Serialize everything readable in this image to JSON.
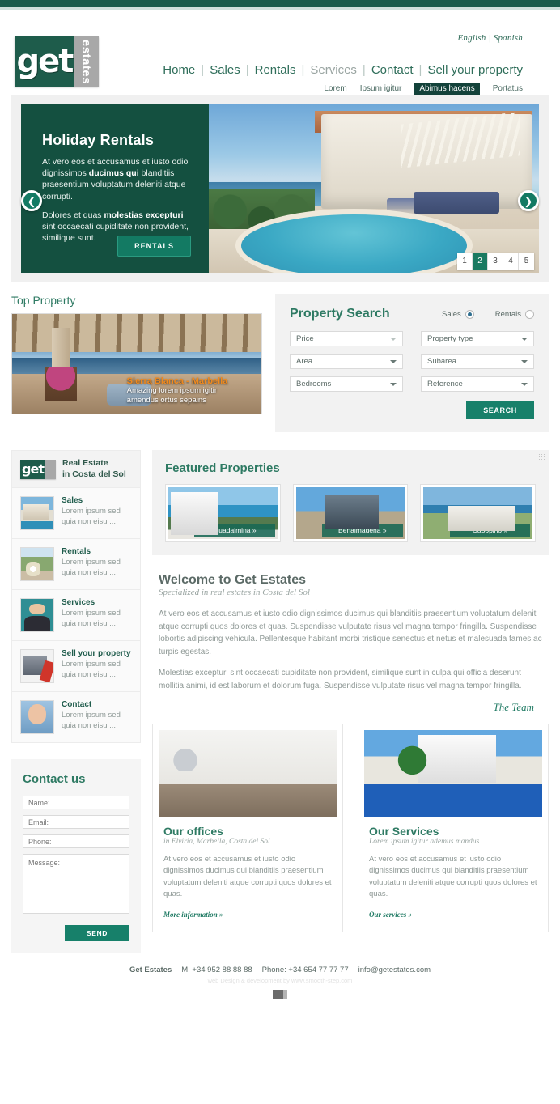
{
  "topbar": {
    "color": "#1a5c4a"
  },
  "header": {
    "lang": {
      "english": "English",
      "separator": "|",
      "spanish": "Spanish"
    },
    "logo": {
      "get": "get",
      "estates": "estates"
    },
    "mainnav": [
      {
        "label": "Home",
        "dim": false
      },
      {
        "label": "Sales",
        "dim": false
      },
      {
        "label": "Rentals",
        "dim": false
      },
      {
        "label": "Services",
        "dim": true
      },
      {
        "label": "Contact",
        "dim": false
      },
      {
        "label": "Sell your property",
        "dim": false
      }
    ],
    "subnav": [
      {
        "label": "Lorem",
        "active": false
      },
      {
        "label": "Ipsum igitur",
        "active": false
      },
      {
        "label": "Abimus hacens",
        "active": true
      },
      {
        "label": "Portatus",
        "active": false
      }
    ]
  },
  "hero": {
    "title": "Holiday Rentals",
    "para1_a": "At vero eos et accusamus et iusto odio dignissimos ",
    "para1_b": "ducimus qui",
    "para1_c": " blanditiis praesentium voluptatum deleniti atque corrupti.",
    "para2_a": "Dolores et quas ",
    "para2_b": "molestias excepturi",
    "para2_c": " sint occaecati cupiditate non provident, similique sunt.",
    "button": "RENTALS",
    "prev_icon": "chevron-left-icon",
    "next_icon": "chevron-right-icon",
    "pages": [
      "1",
      "2",
      "3",
      "4",
      "5"
    ],
    "active_page": "2"
  },
  "top_property": {
    "title": "Top Property",
    "caption_title": "Sierra Blanca - Marbella",
    "caption_text": "Amazing lorem ipsum igitir amendus ortus sepains"
  },
  "search": {
    "title": "Property Search",
    "radios": [
      {
        "label": "Sales",
        "selected": true
      },
      {
        "label": "Rentals",
        "selected": false
      }
    ],
    "fields": [
      {
        "label": "Price",
        "caret": "light"
      },
      {
        "label": "Property type",
        "caret": "dark"
      },
      {
        "label": "Area",
        "caret": "dark"
      },
      {
        "label": "Subarea",
        "caret": "dark"
      },
      {
        "label": "Bedrooms",
        "caret": "dark"
      },
      {
        "label": "Reference",
        "caret": "dark"
      }
    ],
    "button": "SEARCH"
  },
  "sidebar": {
    "head_line1": "Real Estate",
    "head_line2": "in Costa del Sol",
    "items": [
      {
        "label": "Sales",
        "desc": "Lorem ipsum sed quia non eisu ...",
        "thumb": "t-sales"
      },
      {
        "label": "Rentals",
        "desc": "Lorem ipsum sed quia non eisu ...",
        "thumb": "t-rentals"
      },
      {
        "label": "Services",
        "desc": "Lorem ipsum sed quia non eisu ...",
        "thumb": "t-services"
      },
      {
        "label": "Sell your property",
        "desc": "Lorem ipsum sed quia non eisu ...",
        "thumb": "t-sell"
      },
      {
        "label": "Contact",
        "desc": "Lorem ipsum sed quia non eisu ...",
        "thumb": "t-contact"
      }
    ]
  },
  "contact_form": {
    "title": "Contact us",
    "name_placeholder": "Name:",
    "email_placeholder": "Email:",
    "phone_placeholder": "Phone:",
    "message_placeholder": "Message:",
    "send_label": "SEND"
  },
  "featured": {
    "title": "Featured Properties",
    "items": [
      {
        "label": "Guadalmina »",
        "img": "f1"
      },
      {
        "label": "Benalmádena »",
        "img": "f2"
      },
      {
        "label": "Cabopino »",
        "img": "f3"
      }
    ]
  },
  "welcome": {
    "title": "Welcome to Get Estates",
    "subtitle": "Specialized in real estates in Costa del Sol",
    "para1": "At vero eos et accusamus et iusto odio dignissimos ducimus qui blanditiis praesentium voluptatum deleniti atque corrupti quos dolores et quas. Suspendisse vulputate risus vel magna tempor fringilla. Suspendisse lobortis adipiscing vehicula. Pellentesque habitant morbi tristique senectus et netus et malesuada fames ac turpis egestas.",
    "para2": "Molestias excepturi sint occaecati cupiditate non provident, similique sunt in culpa qui officia deserunt mollitia animi, id est laborum et dolorum fuga. Suspendisse vulputate risus vel magna tempor fringilla.",
    "signature": "The Team"
  },
  "cards": [
    {
      "title": "Our offices",
      "subtitle": "in Elviria, Marbella, Costa del Sol",
      "text": "At vero eos et accusamus et iusto odio dignissimos ducimus qui blanditiis praesentium voluptatum deleniti atque corrupti quos dolores et quas.",
      "link": "More information »",
      "img": "c1"
    },
    {
      "title": "Our Services",
      "subtitle": "Lorem ipsum igitur ademus mandus",
      "text": "At vero eos et accusamus et iusto odio dignissimos ducimus qui blanditiis praesentium voluptatum deleniti atque corrupti quos dolores et quas.",
      "link": "Our services »",
      "img": "c2"
    }
  ],
  "footer": {
    "company": "Get Estates",
    "mobile": "M. +34 952 88 88 88",
    "phone": "Phone: +34 654 77 77 77",
    "email": "info@getestates.com",
    "credit": "web Design & development by www.smooth-step.com"
  }
}
